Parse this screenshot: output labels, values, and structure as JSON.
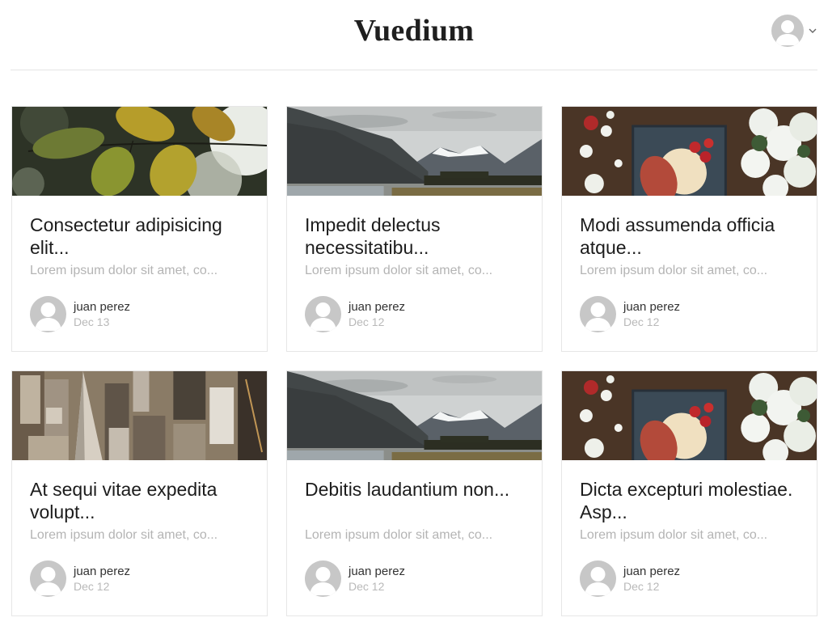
{
  "header": {
    "brand": "Vuedium",
    "user_menu": {
      "avatar_icon": "user-avatar-icon",
      "chevron_icon": "chevron-down-icon"
    }
  },
  "colors": {
    "text_primary": "#1c1c1c",
    "text_muted": "#b4b4b4",
    "border": "#e6e6e6",
    "avatar_bg": "#c7c7c7"
  },
  "posts": [
    {
      "image": "leaves",
      "title": "Consectetur adipisicing elit...",
      "excerpt": "Lorem ipsum dolor sit amet, co...",
      "author": "juan perez",
      "date": "Dec 13"
    },
    {
      "image": "mountains",
      "title": "Impedit delectus necessitatibu...",
      "excerpt": "Lorem ipsum dolor sit amet, co...",
      "author": "juan perez",
      "date": "Dec 12"
    },
    {
      "image": "food",
      "title": "Modi assumenda officia atque...",
      "excerpt": "Lorem ipsum dolor sit amet, co...",
      "author": "juan perez",
      "date": "Dec 12"
    },
    {
      "image": "city",
      "title": "At sequi vitae expedita volupt...",
      "excerpt": "Lorem ipsum dolor sit amet, co...",
      "author": "juan perez",
      "date": "Dec 12"
    },
    {
      "image": "mountains",
      "title": "Debitis laudantium non...",
      "excerpt": "Lorem ipsum dolor sit amet, co...",
      "author": "juan perez",
      "date": "Dec 12"
    },
    {
      "image": "food",
      "title": "Dicta excepturi molestiae. Asp...",
      "excerpt": "Lorem ipsum dolor sit amet, co...",
      "author": "juan perez",
      "date": "Dec 12"
    }
  ]
}
